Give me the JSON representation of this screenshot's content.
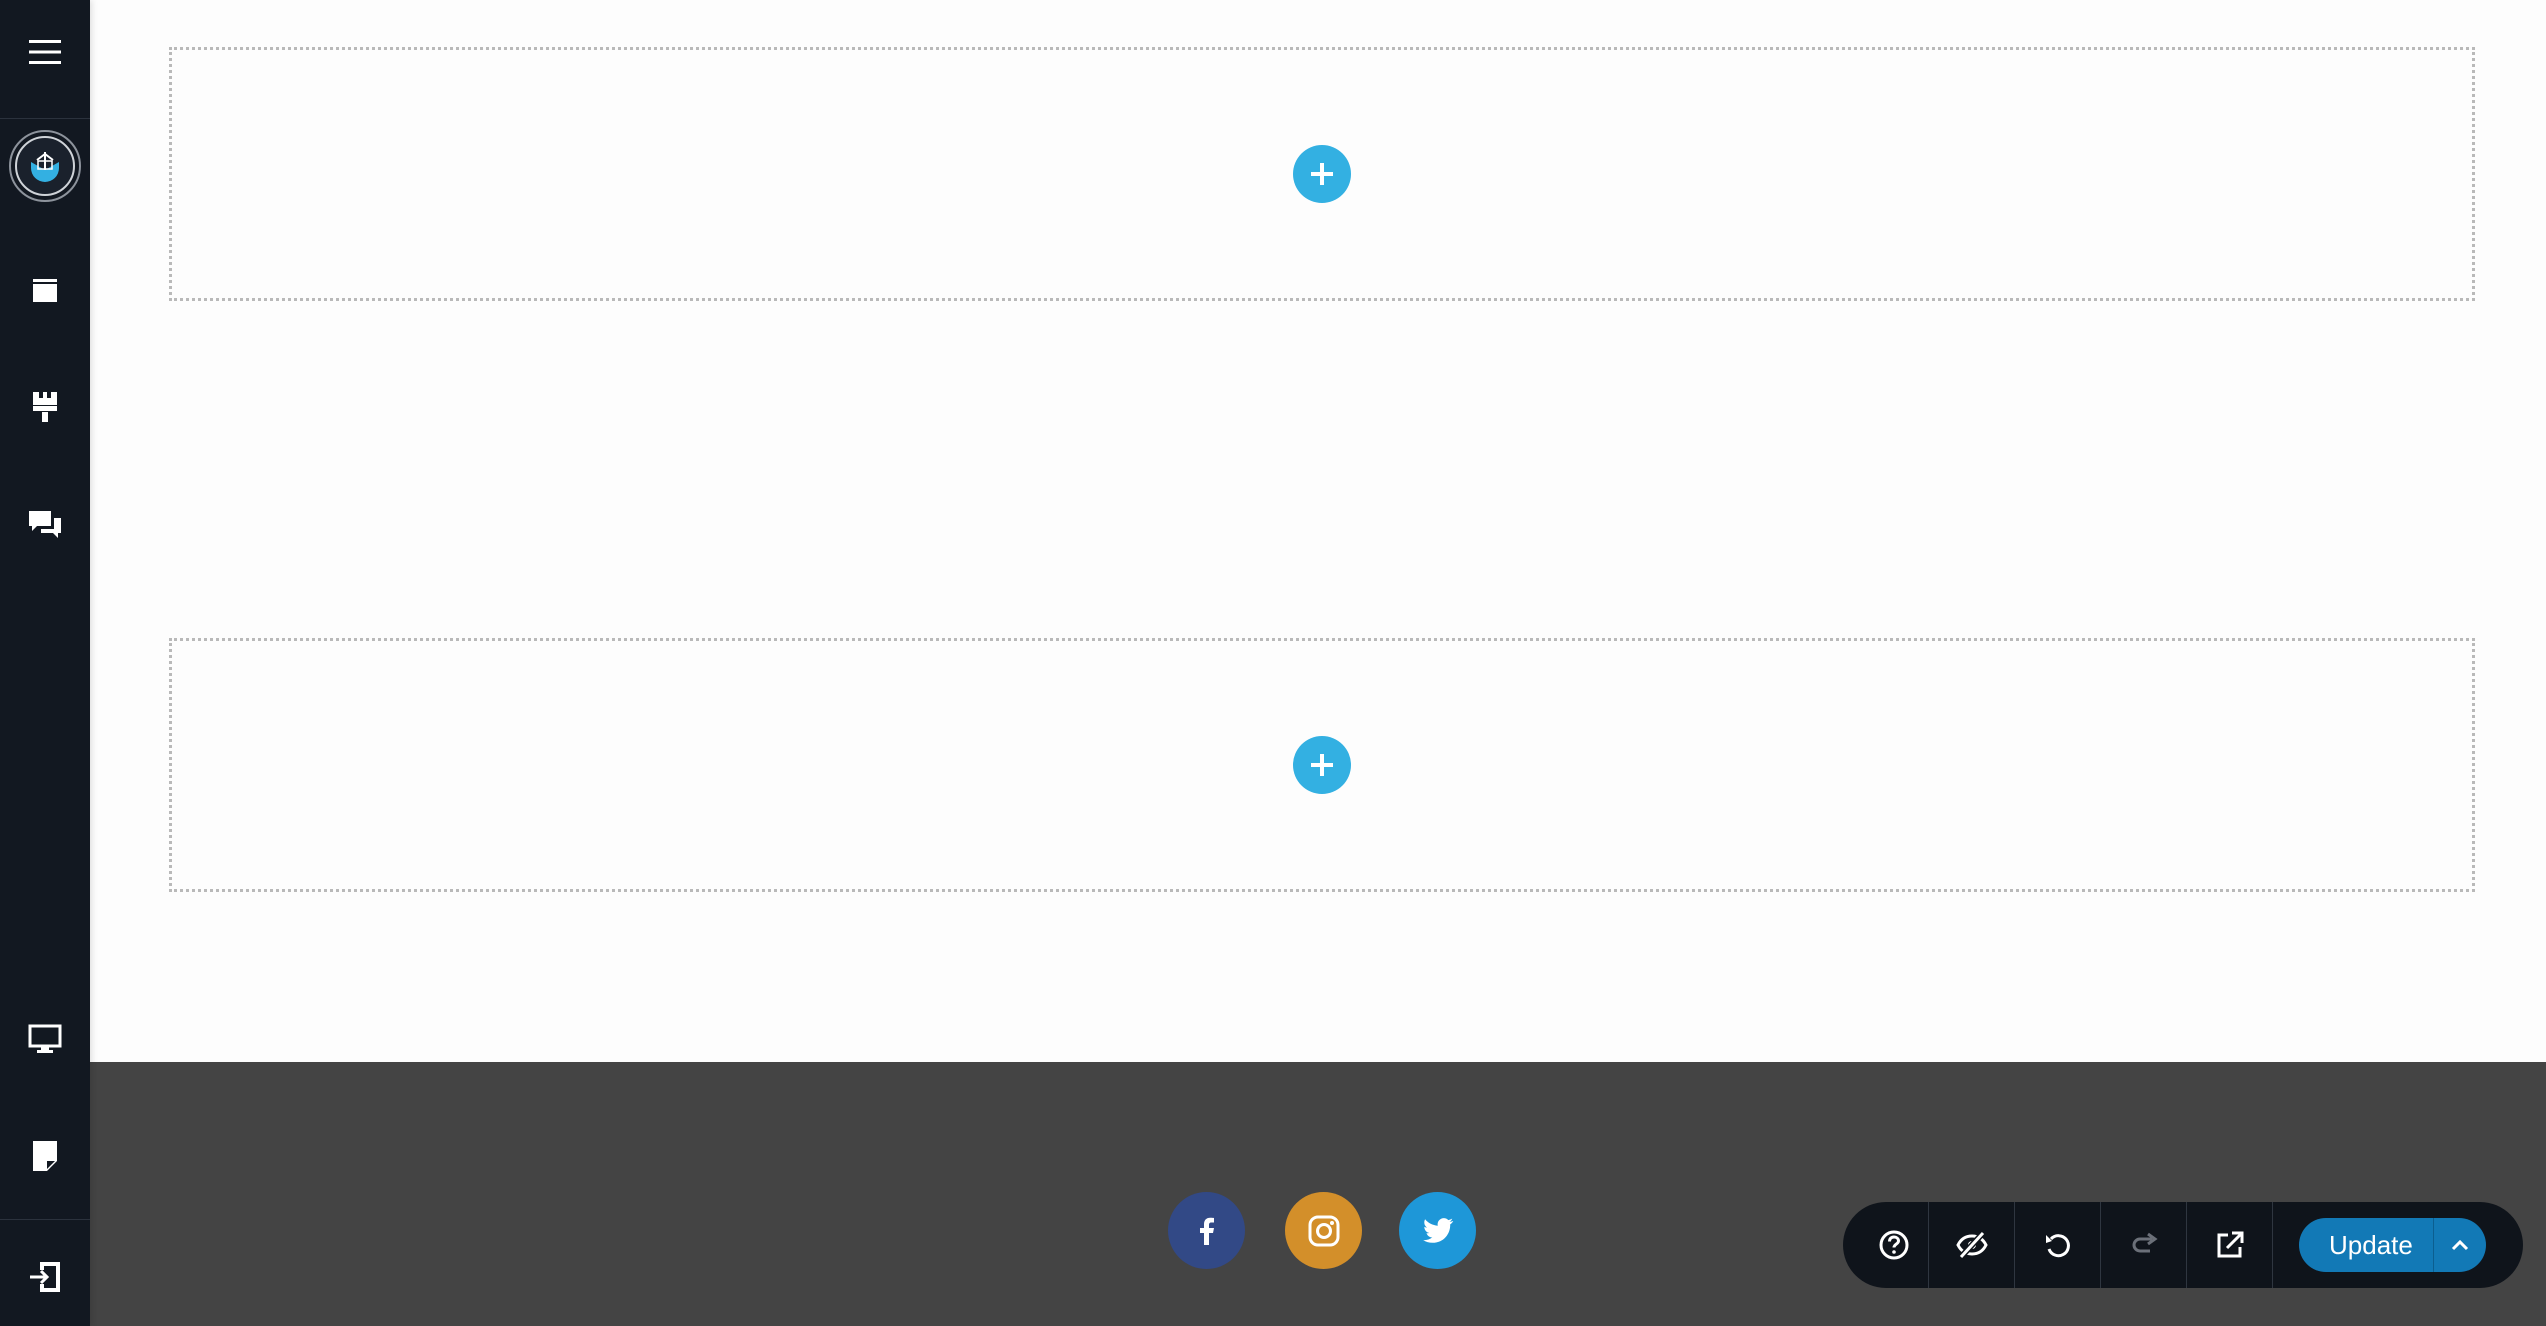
{
  "sidebar": {
    "items": [
      {
        "name": "menu",
        "icon": "hamburger-menu-icon"
      },
      {
        "name": "logo",
        "icon": "brand-logo-icon"
      },
      {
        "name": "pages",
        "icon": "window-icon"
      },
      {
        "name": "design",
        "icon": "paint-roller-icon"
      },
      {
        "name": "comments",
        "icon": "chat-bubbles-icon"
      },
      {
        "name": "preview-desktop",
        "icon": "monitor-icon"
      },
      {
        "name": "notes",
        "icon": "note-icon"
      },
      {
        "name": "exit",
        "icon": "exit-door-icon"
      }
    ]
  },
  "canvas": {
    "drop_zones": [
      {
        "add_icon": "plus-icon"
      },
      {
        "add_icon": "plus-icon"
      }
    ]
  },
  "footer": {
    "social": [
      {
        "network": "facebook",
        "icon": "facebook-icon",
        "color": "#324986"
      },
      {
        "network": "instagram",
        "icon": "instagram-icon",
        "color": "#d38f2a"
      },
      {
        "network": "twitter",
        "icon": "twitter-icon",
        "color": "#1e97d8"
      }
    ],
    "background": "#444444"
  },
  "toolbar": {
    "buttons": [
      {
        "name": "help",
        "icon": "question-circle-icon"
      },
      {
        "name": "hide",
        "icon": "eye-slash-icon"
      },
      {
        "name": "undo",
        "icon": "undo-icon"
      },
      {
        "name": "redo",
        "icon": "redo-icon"
      },
      {
        "name": "open-external",
        "icon": "external-link-icon"
      }
    ],
    "update_label": "Update",
    "accent": "#1279b6"
  },
  "colors": {
    "sidebar_bg": "#121821",
    "add_button": "#33b0e2"
  }
}
